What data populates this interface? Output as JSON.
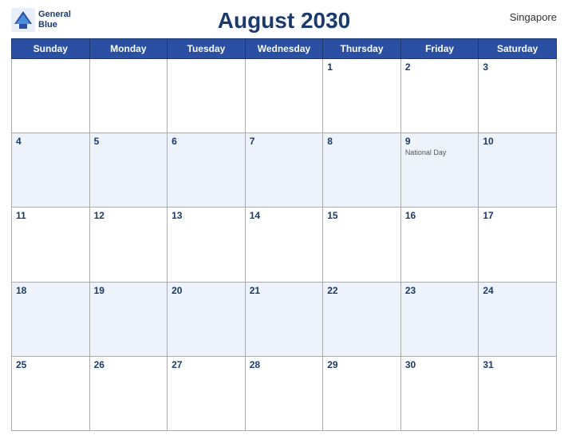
{
  "header": {
    "title": "August 2030",
    "country": "Singapore",
    "logo_line1": "General",
    "logo_line2": "Blue"
  },
  "days_of_week": [
    "Sunday",
    "Monday",
    "Tuesday",
    "Wednesday",
    "Thursday",
    "Friday",
    "Saturday"
  ],
  "weeks": [
    [
      {
        "day": "",
        "holiday": ""
      },
      {
        "day": "",
        "holiday": ""
      },
      {
        "day": "",
        "holiday": ""
      },
      {
        "day": "",
        "holiday": ""
      },
      {
        "day": "1",
        "holiday": ""
      },
      {
        "day": "2",
        "holiday": ""
      },
      {
        "day": "3",
        "holiday": ""
      }
    ],
    [
      {
        "day": "4",
        "holiday": ""
      },
      {
        "day": "5",
        "holiday": ""
      },
      {
        "day": "6",
        "holiday": ""
      },
      {
        "day": "7",
        "holiday": ""
      },
      {
        "day": "8",
        "holiday": ""
      },
      {
        "day": "9",
        "holiday": "National Day"
      },
      {
        "day": "10",
        "holiday": ""
      }
    ],
    [
      {
        "day": "11",
        "holiday": ""
      },
      {
        "day": "12",
        "holiday": ""
      },
      {
        "day": "13",
        "holiday": ""
      },
      {
        "day": "14",
        "holiday": ""
      },
      {
        "day": "15",
        "holiday": ""
      },
      {
        "day": "16",
        "holiday": ""
      },
      {
        "day": "17",
        "holiday": ""
      }
    ],
    [
      {
        "day": "18",
        "holiday": ""
      },
      {
        "day": "19",
        "holiday": ""
      },
      {
        "day": "20",
        "holiday": ""
      },
      {
        "day": "21",
        "holiday": ""
      },
      {
        "day": "22",
        "holiday": ""
      },
      {
        "day": "23",
        "holiday": ""
      },
      {
        "day": "24",
        "holiday": ""
      }
    ],
    [
      {
        "day": "25",
        "holiday": ""
      },
      {
        "day": "26",
        "holiday": ""
      },
      {
        "day": "27",
        "holiday": ""
      },
      {
        "day": "28",
        "holiday": ""
      },
      {
        "day": "29",
        "holiday": ""
      },
      {
        "day": "30",
        "holiday": ""
      },
      {
        "day": "31",
        "holiday": ""
      }
    ]
  ],
  "colors": {
    "header_bg": "#2b4fa3",
    "header_text": "#ffffff",
    "title_color": "#1a3a6b",
    "day_num_color": "#1a3a6b"
  }
}
